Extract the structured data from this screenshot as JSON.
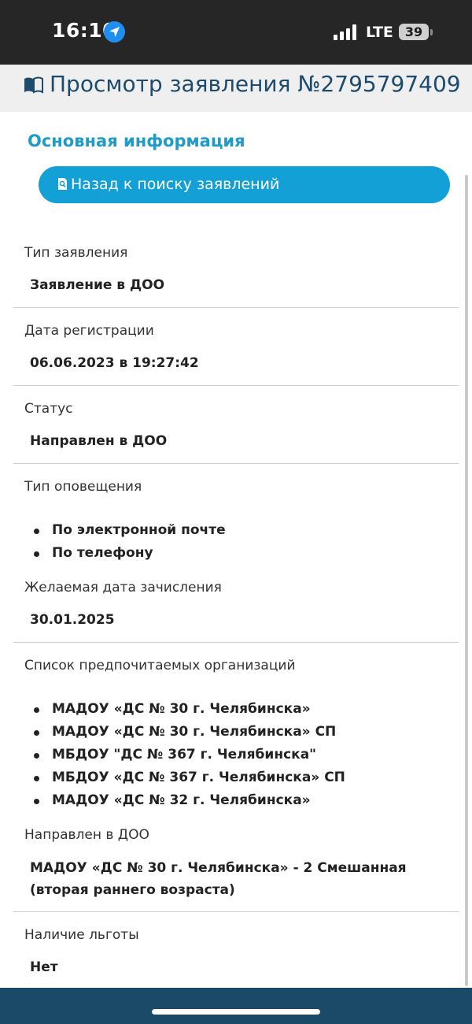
{
  "status_bar": {
    "time": "16:10",
    "network": "LTE",
    "battery": "39"
  },
  "header": {
    "title": "Просмотр заявления №2795797409"
  },
  "section_title": "Основная информация",
  "back_button": {
    "label": "Назад к поиску заявлений"
  },
  "fields": {
    "type": {
      "label": "Тип заявления",
      "value": "Заявление в ДОО"
    },
    "reg_date": {
      "label": "Дата регистрации",
      "value": "06.06.2023 в 19:27:42"
    },
    "status": {
      "label": "Статус",
      "value": "Направлен в ДОО"
    },
    "notification": {
      "label": "Тип оповещения",
      "items": [
        "По электронной почте",
        "По телефону"
      ]
    },
    "enroll_date": {
      "label": "Желаемая дата зачисления",
      "value": "30.01.2025"
    },
    "orgs": {
      "label": "Список предпочитаемых организаций",
      "items": [
        "МАДОУ «ДС № 30 г. Челябинска»",
        "МАДОУ «ДС № 30 г. Челябинска» СП",
        "МБДОУ \"ДС № 367 г. Челябинска\"",
        "МБДОУ «ДС № 367 г. Челябинска» СП",
        "МАДОУ «ДС № 32 г. Челябинска»"
      ]
    },
    "directed": {
      "label": "Направлен в ДОО",
      "value": "МАДОУ «ДС № 30 г. Челябинска» - 2 Смешанная (вторая раннего возраста)"
    },
    "benefit": {
      "label": "Наличие льготы",
      "value": "Нет"
    }
  },
  "colors": {
    "accent": "#12a0d6",
    "title": "#1d4b6d",
    "section": "#1e9bc8",
    "bottom_bar": "#1b4a69"
  }
}
